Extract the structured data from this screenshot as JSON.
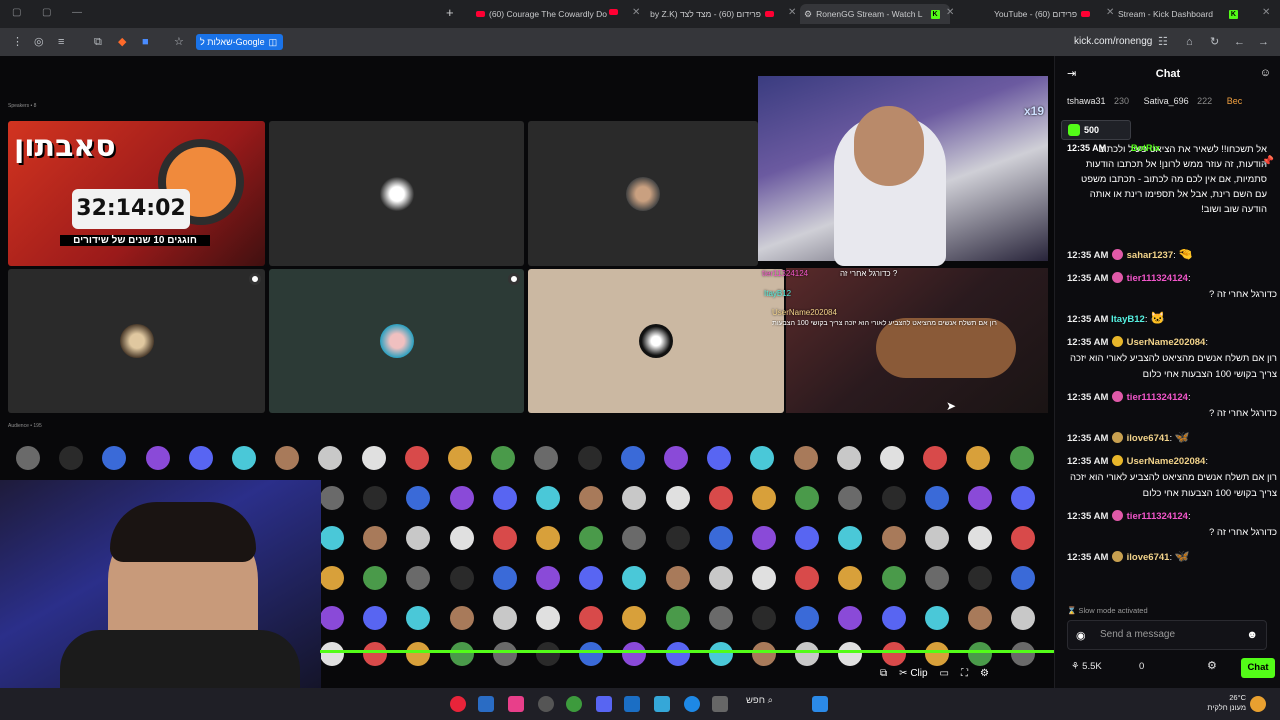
{
  "tabs": [
    {
      "title": "(60) Courage The Cowardly Do"
    },
    {
      "title": "by Z.K) פרידום (60) - מצד לצד"
    },
    {
      "title": "RonenGG Stream - Watch L"
    },
    {
      "title": "YouTube - פרידום (60)"
    },
    {
      "title": "Stream - Kick Dashboard"
    }
  ],
  "toolbar": {
    "bookmark": "שאלות ל-Google",
    "url": "kick.com/ronengg"
  },
  "stream": {
    "speakers_label": "Speakers • 8",
    "audience_label": "Audience • 195",
    "promo_title": "סאבתון",
    "promo_timer": "32:14:02",
    "promo_sub": "חוגגים 10 שנים של שידורים",
    "cam_logo": "x19",
    "overlay_user1": "tier11324124",
    "overlay_msg1": "כדורגל אחרי זה ?",
    "overlay_user2": "ItayB12",
    "overlay_user3": "UserName202084",
    "overlay_msg3": "רון אם תשלח אנשים מהציאט להצביע לאורי הוא יזכה צריך בקושי 100 הצבעות",
    "controls": {
      "clip": "Clip"
    }
  },
  "chat": {
    "title": "Chat",
    "leaders": [
      {
        "name": "tshawa31",
        "score": "230"
      },
      {
        "name": "Sativa_696",
        "score": "222"
      },
      {
        "name": "Bec",
        "score": ""
      }
    ],
    "gift_amount": "500",
    "pinned_prefix": "12:35 AM",
    "pinned_user": "BotRix",
    "pinned_text": "אל תשכחו!! לשאיר את הציאט פעיל ולכתוב הודעות, זה עוזר ממש לרונן! אל תכתבו הודעות סתמיות, אם אין לכם מה לכתוב - תכתבו משפט עם השם רינת, אבל אל תספימו רינת או אותה הודעה שוב ושוב!",
    "messages": [
      {
        "time": "12:35 AM",
        "user": "sahar1237",
        "color": "#f2d38a",
        "badge": "#e05aa8",
        "text": "",
        "emote": "🤏"
      },
      {
        "time": "12:35 AM",
        "user": "tier111324124",
        "color": "#f055c8",
        "badge": "#e05aa8",
        "text": "כדורגל אחרי זה ?",
        "emote": ""
      },
      {
        "time": "12:35 AM",
        "user": "ItayB12",
        "color": "#55f0e0",
        "badge": "",
        "text": "",
        "emote": "🐱"
      },
      {
        "time": "12:35 AM",
        "user": "UserName202084",
        "color": "#f2d38a",
        "badge": "#e8b62a",
        "text": "רון אם תשלח אנשים מהציאט להצביע לאורי הוא יזכה צריך בקושי 100 הצבעות אחי כלום",
        "emote": ""
      },
      {
        "time": "12:35 AM",
        "user": "tier111324124",
        "color": "#f055c8",
        "badge": "#e05aa8",
        "text": "כדורגל אחרי זה ?",
        "emote": ""
      },
      {
        "time": "12:35 AM",
        "user": "ilove6741",
        "color": "#f2d38a",
        "badge": "#c8a050",
        "text": "",
        "emote": "🦋"
      },
      {
        "time": "12:35 AM",
        "user": "UserName202084",
        "color": "#f2d38a",
        "badge": "#e8b62a",
        "text": "רון אם תשלח אנשים מהציאט להצביע לאורי הוא יזכה צריך בקושי 100 הצבעות אחי כלום",
        "emote": ""
      },
      {
        "time": "12:35 AM",
        "user": "tier111324124",
        "color": "#f055c8",
        "badge": "#e05aa8",
        "text": "כדורגל אחרי זה ?",
        "emote": ""
      },
      {
        "time": "12:35 AM",
        "user": "ilove6741",
        "color": "#f2d38a",
        "badge": "#c8a050",
        "text": "",
        "emote": "🦋"
      }
    ],
    "slow_mode": "Slow mode activated",
    "input_placeholder": "Send a message",
    "viewers": "5.5K",
    "count": "0",
    "send_label": "Chat"
  },
  "taskbar": {
    "search": "חפש",
    "temp": "26°C",
    "weather": "מעונן חלקית"
  },
  "colors": {
    "kick_green": "#53fc18",
    "chat_bg": "#0c0c0f",
    "tab_bg": "#202124"
  }
}
